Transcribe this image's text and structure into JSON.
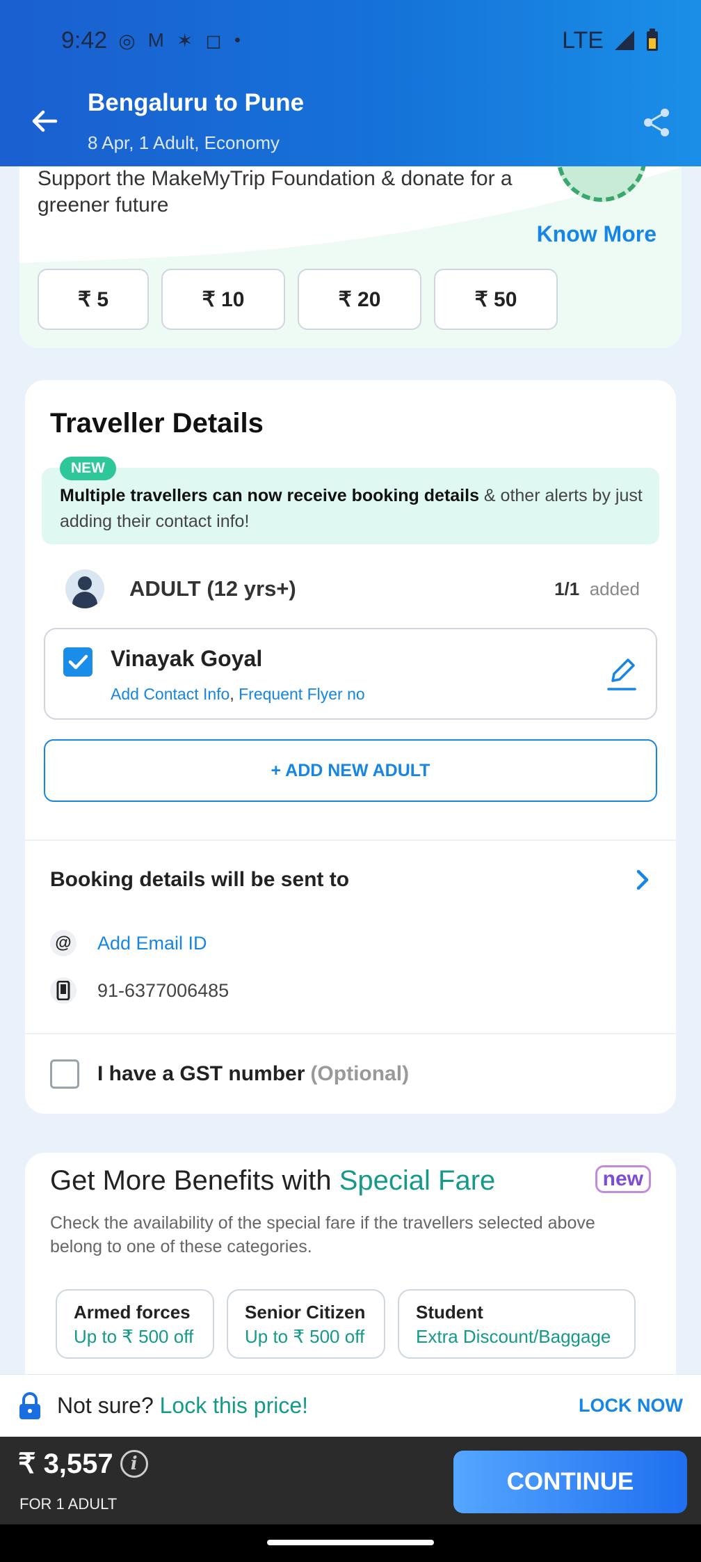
{
  "status_bar": {
    "time": "9:42",
    "network": "LTE",
    "icons": [
      "whatsapp-icon",
      "gmail-icon",
      "notification-icon",
      "instagram-icon",
      "dot-icon"
    ]
  },
  "header": {
    "title": "Bengaluru to Pune",
    "subtitle": "8 Apr, 1 Adult, Economy"
  },
  "donation": {
    "text": "Support the MakeMyTrip Foundation & donate for a greener future",
    "know_more": "Know More",
    "amounts": [
      "₹ 5",
      "₹ 10",
      "₹ 20",
      "₹ 50"
    ]
  },
  "traveller_details": {
    "title": "Traveller Details",
    "notice_badge": "NEW",
    "notice_bold": "Multiple travellers can now receive booking details",
    "notice_rest": " & other alerts by just adding their contact info!",
    "adult_label": "ADULT (12 yrs+)",
    "adult_count": "1/1",
    "adult_count_suffix": "added",
    "traveller_name": "Vinayak Goyal",
    "link_contact": "Add Contact Info",
    "link_separator": ",",
    "link_flyer": "Frequent Flyer no",
    "add_adult": "+ ADD NEW ADULT",
    "booking_sent_to": "Booking details will be sent to",
    "email_symbol": "@",
    "email_label": "Add Email ID",
    "phone": "91-6377006485",
    "gst_label": "I have a GST number",
    "gst_optional": "(Optional)"
  },
  "special_fare": {
    "title_prefix": "Get More Benefits with ",
    "title_highlight": "Special Fare",
    "new_tag": "new",
    "description": "Check the availability of the special fare if the travellers selected above belong to one of these categories.",
    "categories": [
      {
        "title": "Armed forces",
        "subtitle": "Up to ₹ 500 off"
      },
      {
        "title": "Senior Citizen",
        "subtitle": "Up to ₹ 500 off"
      },
      {
        "title": "Student",
        "subtitle": "Extra Discount/Baggage"
      }
    ]
  },
  "lock_bar": {
    "question": "Not sure?",
    "highlight": " Lock this price!",
    "action": "LOCK NOW"
  },
  "price_bar": {
    "price": "₹ 3,557",
    "info_symbol": "i",
    "for_label": "FOR 1 ADULT",
    "continue": "CONTINUE"
  },
  "colors": {
    "primary_blue": "#1585e6",
    "teal": "#159a8a",
    "header_start": "#1b5fd0",
    "header_end": "#1a8fe8"
  }
}
